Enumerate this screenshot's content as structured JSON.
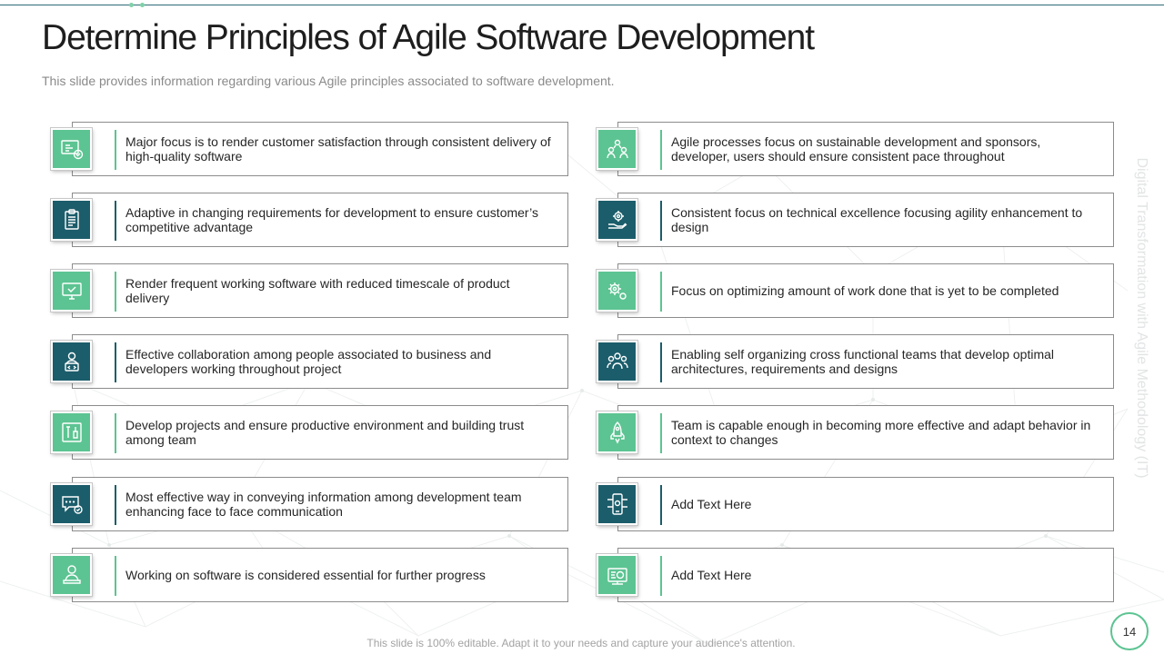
{
  "slide": {
    "title": "Determine Principles of Agile Software Development",
    "subtitle": "This slide provides information regarding various Agile principles associated to software development.",
    "side_label": "Digital Transformation with Agile Methodology (IT)",
    "page_number": "14",
    "footer": "This slide is 100% editable. Adapt it to your needs and capture your audience's attention."
  },
  "colors": {
    "green": "#5cc492",
    "teal": "#1c5d6b",
    "border": "#8c8c8c"
  },
  "left_cards": [
    {
      "icon": "dashboard-check-icon",
      "tone": "green",
      "text": "Major focus is to render customer satisfaction through consistent delivery of high-quality software"
    },
    {
      "icon": "clipboard-icon",
      "tone": "teal",
      "text": "Adaptive in changing requirements for development to ensure customer’s competitive advantage"
    },
    {
      "icon": "monitor-check-icon",
      "tone": "green",
      "text": "Render frequent working software with  reduced timescale of product delivery"
    },
    {
      "icon": "developer-laptop-icon",
      "tone": "teal",
      "text": "Effective collaboration among people associated to business and developers working throughout project"
    },
    {
      "icon": "tools-icon",
      "tone": "green",
      "text": "Develop projects and ensure productive environment and building trust among team"
    },
    {
      "icon": "chat-bubble-icon",
      "tone": "teal",
      "text": "Most effective way  in conveying information among development team enhancing face to face communication"
    },
    {
      "icon": "person-laptop-icon",
      "tone": "green",
      "text": "Working on software is considered essential for further progress"
    }
  ],
  "right_cards": [
    {
      "icon": "team-network-icon",
      "tone": "green",
      "text": "Agile processes focus on sustainable development and sponsors, developer, users should ensure consistent pace throughout"
    },
    {
      "icon": "hand-gear-icon",
      "tone": "teal",
      "text": "Consistent focus on technical excellence  focusing agility enhancement to design"
    },
    {
      "icon": "gears-icon",
      "tone": "green",
      "text": "Focus on optimizing  amount of work done that is yet to be completed"
    },
    {
      "icon": "team-group-icon",
      "tone": "teal",
      "text": "Enabling self organizing cross functional teams that develop optimal architectures, requirements and designs"
    },
    {
      "icon": "rocket-icon",
      "tone": "green",
      "text": "Team is capable enough in becoming more effective and adapt behavior in context to changes"
    },
    {
      "icon": "phone-circuit-icon",
      "tone": "teal",
      "text": "Add Text Here"
    },
    {
      "icon": "dollar-board-icon",
      "tone": "green",
      "text": "Add Text Here"
    }
  ]
}
